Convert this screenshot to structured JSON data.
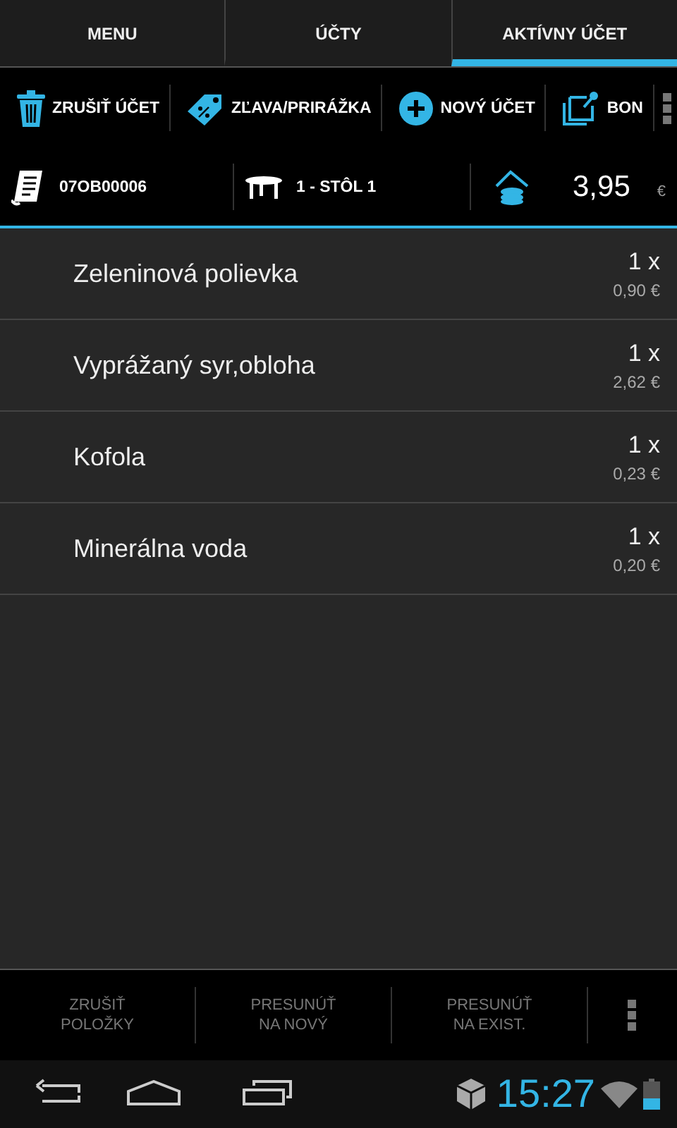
{
  "tabs": [
    {
      "label": "MENU",
      "selected": false
    },
    {
      "label": "ÚČTY",
      "selected": false
    },
    {
      "label": "AKTÍVNY ÚČET",
      "selected": true
    }
  ],
  "toolbar": [
    {
      "kind": "trash",
      "label": "ZRUŠIŤ ÚČET"
    },
    {
      "kind": "tag",
      "label": "ZĽAVA/PRIRÁŽKA"
    },
    {
      "kind": "plus",
      "label": "NOVÝ ÚČET"
    },
    {
      "kind": "bon",
      "label": "BON"
    }
  ],
  "info": {
    "bill_number": "07OB00006",
    "table": "1 - STÔL 1",
    "total": "3,95",
    "currency": "€"
  },
  "items": [
    {
      "name": "Zeleninová polievka",
      "quantity": "1 x",
      "price": "0,90 €"
    },
    {
      "name": "Vyprážaný syr,obloha",
      "quantity": "1 x",
      "price": "2,62 €"
    },
    {
      "name": "Kofola",
      "quantity": "1 x",
      "price": "0,23 €"
    },
    {
      "name": "Minerálna voda",
      "quantity": "1 x",
      "price": "0,20 €"
    }
  ],
  "actions": [
    {
      "label": "ZRUŠIŤ\nPOLOŽKY",
      "disabled": true
    },
    {
      "label": "PRESUNÚŤ\nNA NOVÝ",
      "disabled": true
    },
    {
      "label": "PRESUNÚŤ\nNA EXIST.",
      "disabled": true
    }
  ],
  "status_bar": {
    "time": "15:27"
  }
}
